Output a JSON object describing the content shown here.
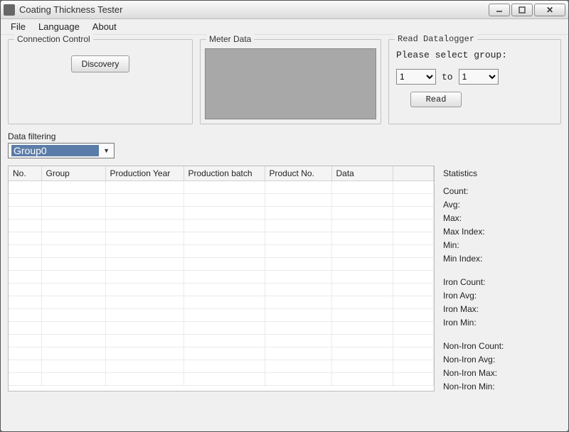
{
  "window": {
    "title": "Coating Thickness Tester"
  },
  "menu": {
    "file": "File",
    "language": "Language",
    "about": "About"
  },
  "connection": {
    "legend": "Connection Control",
    "discovery": "Discovery"
  },
  "meter": {
    "legend": "Meter Data"
  },
  "reader": {
    "legend": "Read Datalogger",
    "prompt": "Please select group:",
    "from": "1",
    "to_label": "to",
    "to": "1",
    "read": "Read"
  },
  "filter": {
    "label": "Data filtering",
    "selected": "Group0"
  },
  "table": {
    "cols": {
      "no": "No.",
      "group": "Group",
      "year": "Production Year",
      "batch": "Production batch",
      "product": "Product No.",
      "data": "Data"
    }
  },
  "stats": {
    "header": "Statistics",
    "count": "Count:",
    "avg": "Avg:",
    "max": "Max:",
    "max_index": "Max Index:",
    "min": "Min:",
    "min_index": "Min Index:",
    "iron_count": "Iron Count:",
    "iron_avg": "Iron Avg:",
    "iron_max": "Iron Max:",
    "iron_min": "Iron Min:",
    "non_iron_count": "Non-Iron Count:",
    "non_iron_avg": "Non-Iron Avg:",
    "non_iron_max": "Non-Iron Max:",
    "non_iron_min": "Non-Iron Min:"
  }
}
